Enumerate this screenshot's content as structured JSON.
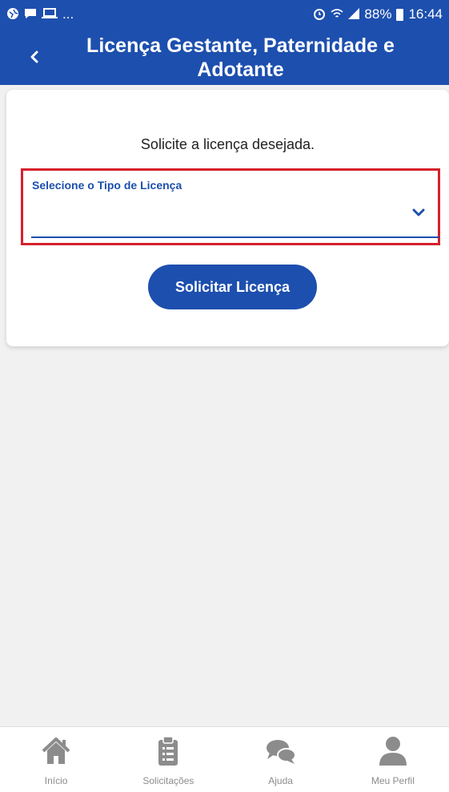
{
  "status_bar": {
    "left_icons": [
      "globe-icon",
      "chat-icon",
      "laptop-icon"
    ],
    "left_more": "...",
    "battery_percent": "88%",
    "time": "16:44"
  },
  "header": {
    "title": "Licença Gestante, Paternidade e Adotante",
    "back_icon": "chevron-left-icon"
  },
  "main": {
    "subtitle": "Solicite a licença desejada.",
    "select": {
      "label": "Selecione o Tipo de Licença",
      "value": ""
    },
    "button_label": "Solicitar Licença"
  },
  "bottom_nav": {
    "items": [
      {
        "label": "Início",
        "icon": "home-icon"
      },
      {
        "label": "Solicitações",
        "icon": "clipboard-icon"
      },
      {
        "label": "Ajuda",
        "icon": "chat-bubbles-icon"
      },
      {
        "label": "Meu Perfil",
        "icon": "user-icon"
      }
    ]
  },
  "colors": {
    "brand_blue": "#1d4fae",
    "highlight_red": "#d6202c",
    "nav_gray": "#8c8c8c"
  }
}
